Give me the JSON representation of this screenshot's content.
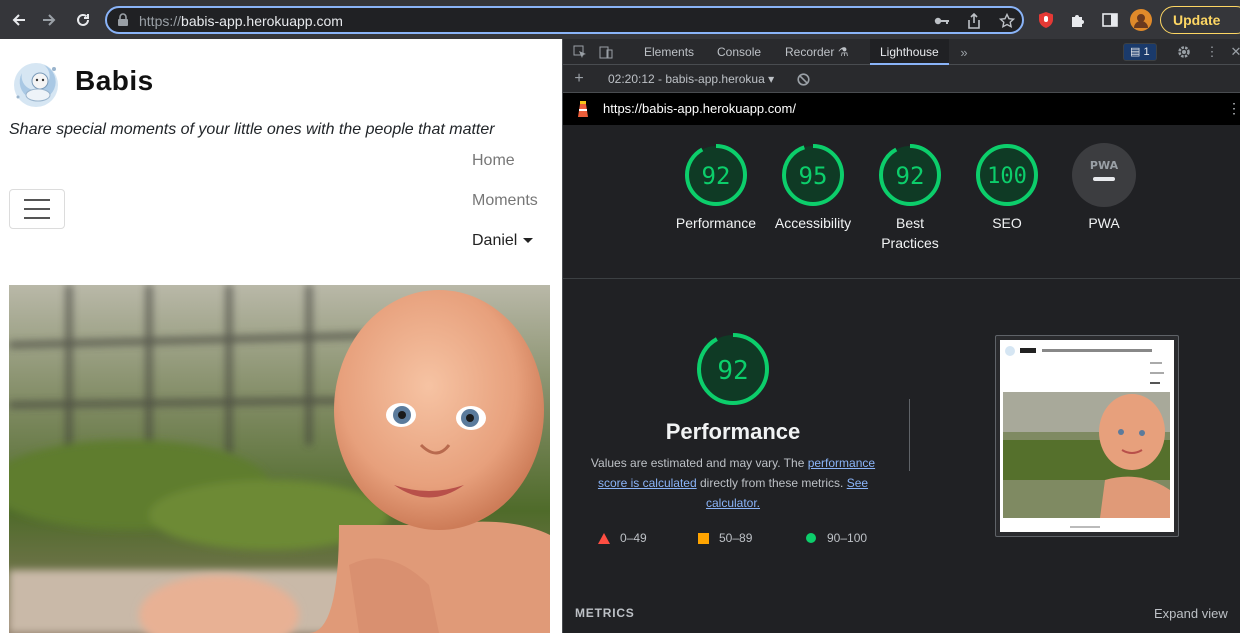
{
  "browser": {
    "url_prefix": "https://",
    "url_host": "babis-app.herokuapp.com",
    "update_label": "Update"
  },
  "page": {
    "brand": "Babis",
    "tagline": "Share special moments of your little ones with the people that matter",
    "nav": {
      "home": "Home",
      "moments": "Moments",
      "user": "Daniel"
    }
  },
  "devtools": {
    "tabs": {
      "elements": "Elements",
      "console": "Console",
      "recorder": "Recorder",
      "lighthouse": "Lighthouse"
    },
    "issues_count": "1",
    "report_time": "02:20:12 - babis-app.herokua",
    "report_url": "https://babis-app.herokuapp.com/",
    "gauges": [
      {
        "score": "92",
        "label": "Performance"
      },
      {
        "score": "95",
        "label": "Accessibility"
      },
      {
        "score": "92",
        "label": "Best Practices"
      },
      {
        "score": "100",
        "label": "SEO"
      },
      {
        "score": "PWA",
        "label": "PWA"
      }
    ],
    "performance": {
      "score": "92",
      "title": "Performance",
      "desc_prefix": "Values are estimated and may vary. The ",
      "desc_link1": "performance score is calculated",
      "desc_mid": " directly from these metrics. ",
      "desc_link2": "See calculator."
    },
    "legend": {
      "fail": "0–49",
      "average": "50–89",
      "pass": "90–100"
    },
    "metrics_label": "METRICS",
    "expand_label": "Expand view",
    "colors": {
      "pass": "#0cce6b",
      "average": "#ffa400",
      "fail": "#ff4e42",
      "accent": "#8ab4f8"
    }
  }
}
